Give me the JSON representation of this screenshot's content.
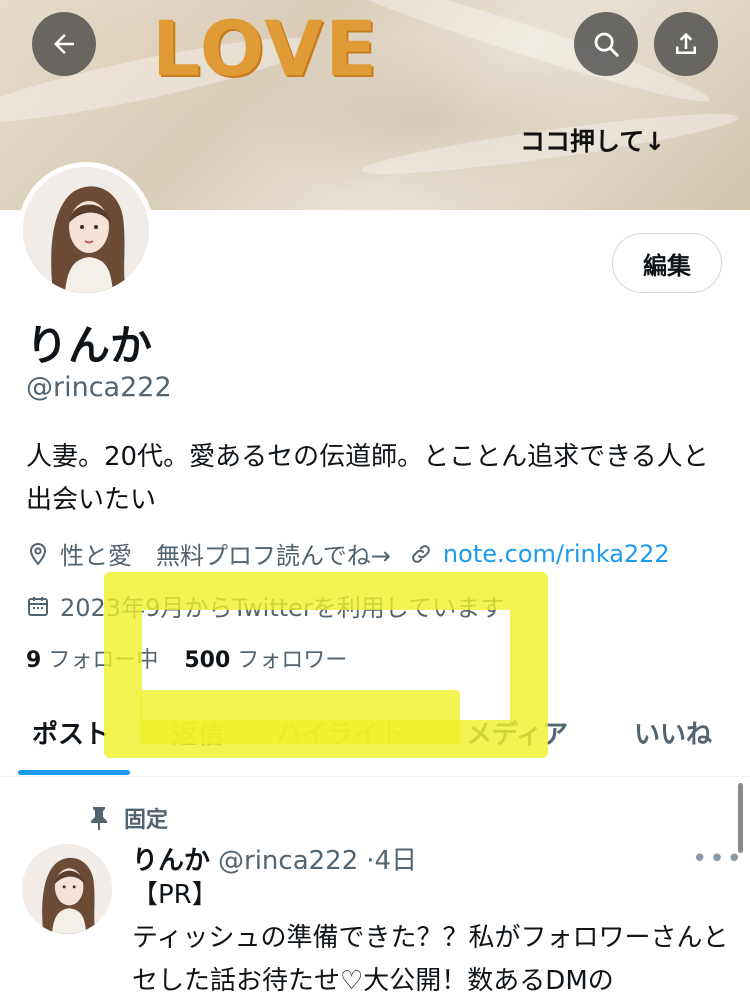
{
  "banner": {
    "decor_text": "LOVE",
    "annotation": "ココ押して↓"
  },
  "header": {
    "back_icon": "arrow-left-icon",
    "search_icon": "search-icon",
    "share_icon": "share-icon"
  },
  "profile": {
    "edit_label": "編集",
    "name": "りんか",
    "handle": "@rinca222",
    "bio": "人妻。20代。愛あるセの伝道師。とことん追求できる人と出会いたい",
    "location": "性と愛　無料プロフ読んでね→",
    "website": "note.com/rinka222",
    "joined": "2023年9月からTwitterを利用しています",
    "following_count": "9",
    "following_label": "フォロー中",
    "followers_count": "500",
    "followers_label": "フォロワー"
  },
  "tabs": [
    {
      "label": "ポスト"
    },
    {
      "label": "返信"
    },
    {
      "label": "ハイライト"
    },
    {
      "label": "メディア"
    },
    {
      "label": "いいね"
    }
  ],
  "post": {
    "pinned_label": "固定",
    "author_name": "りんか",
    "author_handle": "@rinca222",
    "time": "·4日",
    "more": "•••",
    "line1": "【PR】",
    "line2": "ティッシュの準備できた？？私がフォロワーさんとセした話お待たせ♡大公開！数あるDMの"
  },
  "colors": {
    "accent": "#1d9bf0",
    "highlight": "#f0f028",
    "love": "#e09a36"
  }
}
